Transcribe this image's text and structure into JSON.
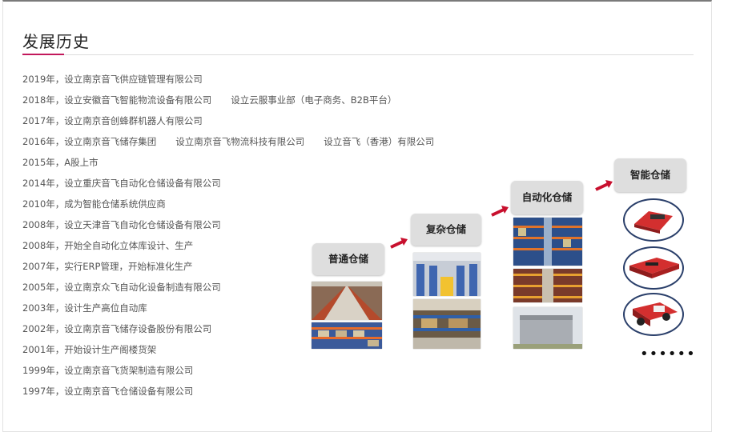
{
  "section_title": "发展历史",
  "timeline": [
    {
      "text": "2019年，设立南京音飞供应链管理有限公司",
      "extras": []
    },
    {
      "text": "2018年，设立安徽音飞智能物流设备有限公司",
      "extras": [
        "设立云服事业部（电子商务、B2B平台）"
      ]
    },
    {
      "text": "2017年，设立南京音创蜂群机器人有限公司",
      "extras": []
    },
    {
      "text": "2016年，设立南京音飞储存集团",
      "extras": [
        "设立南京音飞物流科技有限公司",
        "设立音飞（香港）有限公司"
      ]
    },
    {
      "text": "2015年，A股上市",
      "extras": []
    },
    {
      "text": "2014年，设立重庆音飞自动化仓储设备有限公司",
      "extras": []
    },
    {
      "text": "2010年，成为智能仓储系统供应商",
      "extras": []
    },
    {
      "text": "2008年，设立天津音飞自动化仓储设备有限公司",
      "extras": []
    },
    {
      "text": "2008年，开始全自动化立体库设计、生产",
      "extras": []
    },
    {
      "text": "2007年，实行ERP管理，开始标准化生产",
      "extras": []
    },
    {
      "text": "2005年，设立南京众飞自动化设备制造有限公司",
      "extras": []
    },
    {
      "text": "2003年，设计生产高位自动库",
      "extras": []
    },
    {
      "text": "2002年，设立南京音飞储存设备股份有限公司",
      "extras": []
    },
    {
      "text": "2001年，开始设计生产阁楼货架",
      "extras": []
    },
    {
      "text": "1999年，设立南京音飞货架制造有限公司",
      "extras": []
    },
    {
      "text": "1997年，设立南京音飞仓储设备有限公司",
      "extras": []
    }
  ],
  "stages": {
    "s1": "普通仓储",
    "s2": "复杂仓储",
    "s3": "自动化仓储",
    "s4": "智能仓储"
  },
  "more_indicator": "••••••",
  "colors": {
    "accent": "#c2185b",
    "arrow": "#c8102e",
    "robot": "#d32f2f",
    "robot_ring": "#2a3f6a"
  }
}
